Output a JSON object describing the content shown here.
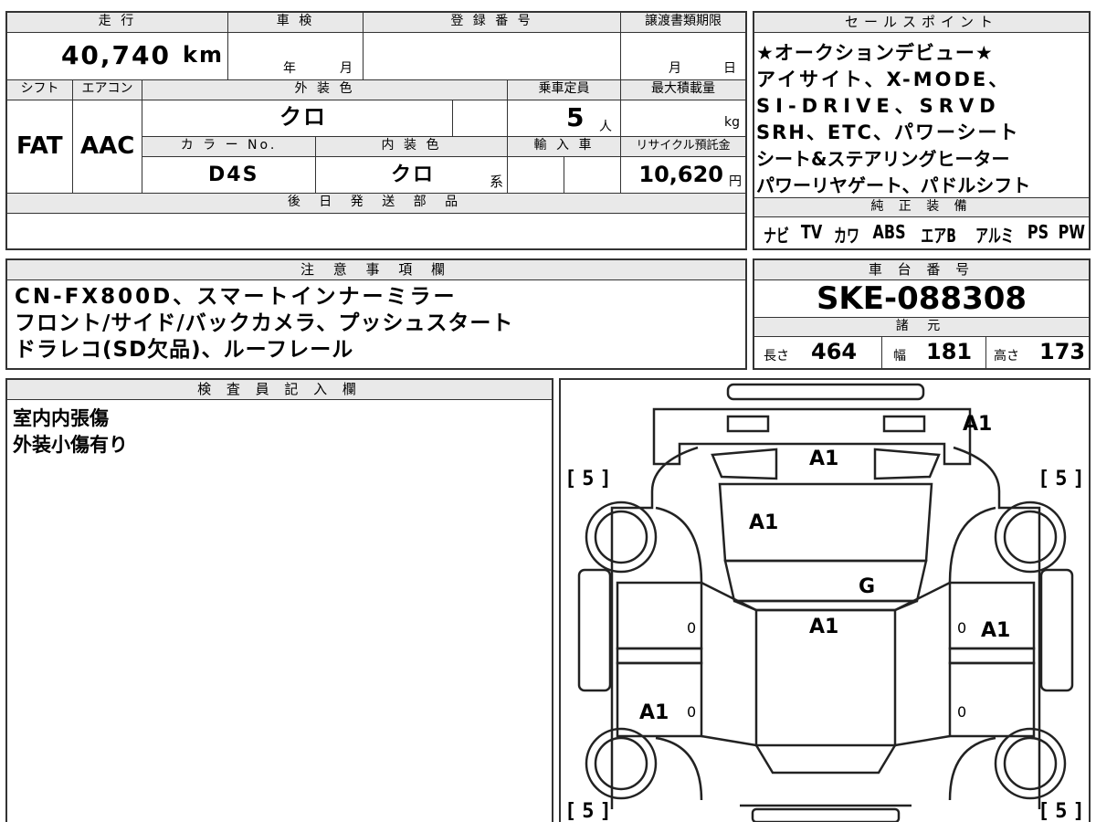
{
  "top_row": {
    "mileage_label": "走 行",
    "mileage_value": "40,740",
    "mileage_unit": "km",
    "inspection_label": "車 検",
    "year_unit": "年",
    "month_unit": "月",
    "registration_label": "登 録 番 号",
    "deadline_label": "譲渡書類期限",
    "deadline_month": "月",
    "deadline_day": "日"
  },
  "row2": {
    "shift_label": "シフト",
    "shift_value": "FAT",
    "aircon_label": "エアコン",
    "aircon_value": "AAC",
    "exterior_label": "外 装 色",
    "exterior_value": "クロ",
    "capacity_label": "乗車定員",
    "capacity_value": "5",
    "capacity_unit": "人",
    "maxload_label": "最大積載量",
    "maxload_unit": "kg",
    "color_no_label": "カ ラ ー No.",
    "color_no_value": "D4S",
    "interior_label": "内 装 色",
    "interior_value": "クロ",
    "interior_unit": "系",
    "import_label": "輸 入 車",
    "recycle_label": "リサイクル預託金",
    "recycle_value": "10,620",
    "recycle_unit": "円"
  },
  "later_parts": {
    "label": "後 日 発 送 部 品"
  },
  "sales_points": {
    "label": "セールスポイント",
    "lines": [
      "★オークションデビュー★",
      "アイサイト、X-MODE、",
      "SI-DRIVE、SRVD",
      "SRH、ETC、パワーシート",
      "シート&ステアリングヒーター",
      "パワーリヤゲート、パドルシフト"
    ]
  },
  "genuine_equipment": {
    "label": "純 正 装 備",
    "items": [
      "ナビ",
      "TV",
      "カワ",
      "ABS",
      "エアB",
      "アルミ",
      "PS",
      "PW"
    ]
  },
  "notes": {
    "label": "注 意 事 項 欄",
    "lines": [
      "CN-FX800D、スマートインナーミラー",
      "フロント/サイド/バックカメラ、プッシュスタート",
      "ドラレコ(SD欠品)、ルーフレール"
    ]
  },
  "chassis": {
    "label": "車 台 番 号",
    "value": "SKE-088308"
  },
  "specs": {
    "label": "諸 元",
    "length_label": "長さ",
    "length_value": "464",
    "width_label": "幅",
    "width_value": "181",
    "height_label": "高さ",
    "height_value": "173"
  },
  "inspector": {
    "label": "検 査 員 記 入 欄",
    "lines": [
      "室内内張傷",
      "外装小傷有り"
    ]
  },
  "diagram": {
    "marks": {
      "rear_top": "A1",
      "rear_glass": "A1",
      "roof": "A1",
      "windshield": "G",
      "hood": "A1",
      "right_front_door": "A1",
      "left_rear_fender": "A1",
      "zero": "0"
    },
    "tires": {
      "tl": "5",
      "tr": "5",
      "bl": "5",
      "br": "5"
    }
  }
}
